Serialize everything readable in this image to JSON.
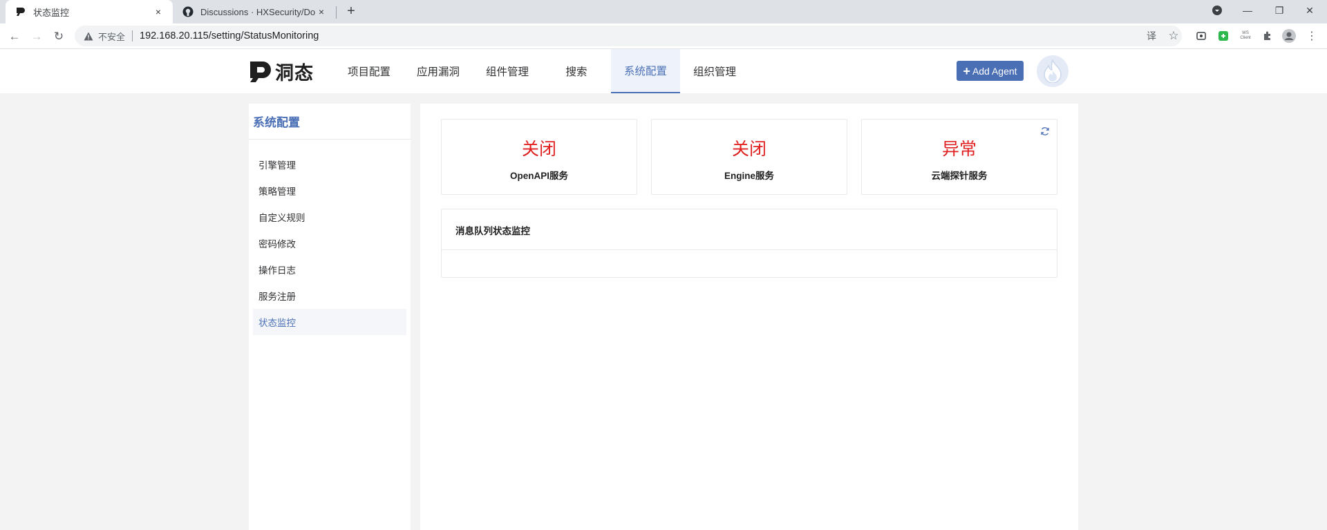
{
  "browser": {
    "tabs": [
      {
        "title": "状态监控",
        "close": "×"
      },
      {
        "title": "Discussions · HXSecurity/DongTai",
        "close": "×"
      }
    ],
    "new_tab": "+",
    "window": {
      "minimize": "—",
      "maximize": "❐",
      "close": "✕"
    },
    "nav": {
      "back": "←",
      "forward": "→",
      "reload": "↻"
    },
    "address": {
      "insecure_label": "不安全",
      "url": "192.168.20.115/setting/StatusMonitoring"
    },
    "extensions": {
      "translate": "译",
      "bookmark": "☆",
      "ws_client": "WS Client",
      "more": "⋮"
    }
  },
  "header": {
    "logo_text": "洞态",
    "nav": [
      "项目配置",
      "应用漏洞",
      "组件管理",
      "搜索",
      "系统配置",
      "组织管理"
    ],
    "active_nav": "系统配置",
    "add_agent_icon": "+",
    "add_agent_label": "Add Agent"
  },
  "sidebar": {
    "title": "系统配置",
    "items": [
      "引擎管理",
      "策略管理",
      "自定义规则",
      "密码修改",
      "操作日志",
      "服务注册",
      "状态监控"
    ],
    "active_item": "状态监控"
  },
  "main": {
    "status_cards": [
      {
        "value": "关闭",
        "label": "OpenAPI服务"
      },
      {
        "value": "关闭",
        "label": "Engine服务"
      },
      {
        "value": "异常",
        "label": "云端探针服务"
      }
    ],
    "mq_title": "消息队列状态监控"
  },
  "colors": {
    "accent": "#4a6fb5",
    "danger": "#e02020",
    "background": "#f3f3f3"
  }
}
